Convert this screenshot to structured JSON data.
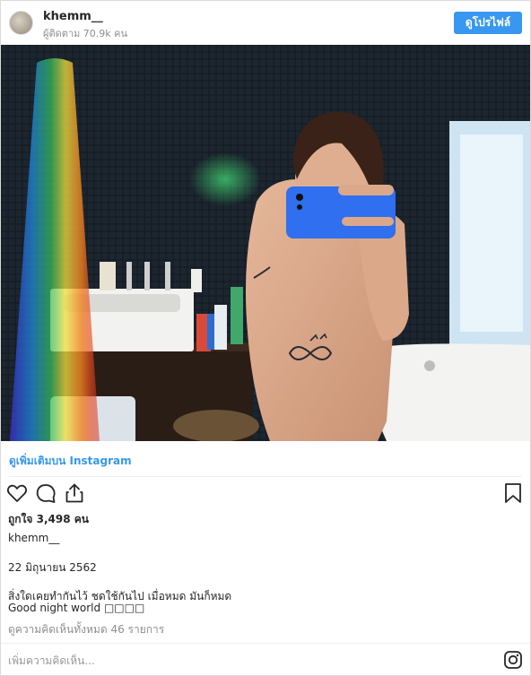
{
  "header": {
    "username": "khemm__",
    "followers": "ผู้ติดตาม 70.9k คน",
    "profile_button": "ดูโปรไฟล์"
  },
  "photo": {
    "description_icon": "photo"
  },
  "links": {
    "view_more": "ดูเพิ่มเติมบน Instagram"
  },
  "actions": {
    "like_icon": "heart-icon",
    "comment_icon": "comment-icon",
    "share_icon": "share-icon",
    "save_icon": "bookmark-icon"
  },
  "post": {
    "likes": "ถูกใจ 3,498 คน",
    "author": "khemm__",
    "date": "22 มิถุนายน 2562",
    "caption_line1": "สิ่งใดเคยทำกันไว้ ชดใช้กันไป เมื่อหมด มันก็หมด",
    "caption_line2": "Good night world □□□□",
    "comments_link": "ดูความคิดเห็นทั้งหมด 46 รายการ"
  },
  "comment": {
    "placeholder": "เพิ่มความคิดเห็น..."
  },
  "colors": {
    "accent": "#3897f0",
    "text": "#262626",
    "muted": "#8e8e8e"
  }
}
